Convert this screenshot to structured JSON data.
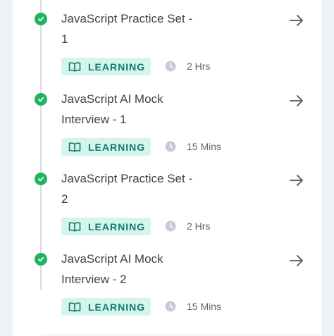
{
  "colors": {
    "check": "#22b35e",
    "badge_bg": "#d4f5ee",
    "badge_text": "#127a66",
    "title_text": "#3a4350"
  },
  "items": [
    {
      "title_line1": "JavaScript Practice Set -",
      "title_line2": "1",
      "badge": "LEARNING",
      "duration": "2 Hrs",
      "icons": [
        "check-circle-icon",
        "book-open-icon",
        "clock-icon",
        "arrow-right-icon"
      ]
    },
    {
      "title_line1": "JavaScript AI Mock",
      "title_line2": "Interview - 1",
      "badge": "LEARNING",
      "duration": "15 Mins",
      "icons": [
        "check-circle-icon",
        "book-open-icon",
        "clock-icon",
        "arrow-right-icon"
      ]
    },
    {
      "title_line1": "JavaScript Practice Set -",
      "title_line2": "2",
      "badge": "LEARNING",
      "duration": "2 Hrs",
      "icons": [
        "check-circle-icon",
        "book-open-icon",
        "clock-icon",
        "arrow-right-icon"
      ]
    },
    {
      "title_line1": "JavaScript AI Mock",
      "title_line2": "Interview - 2",
      "badge": "LEARNING",
      "duration": "15 Mins",
      "icons": [
        "check-circle-icon",
        "book-open-icon",
        "clock-icon",
        "arrow-right-icon"
      ]
    }
  ]
}
